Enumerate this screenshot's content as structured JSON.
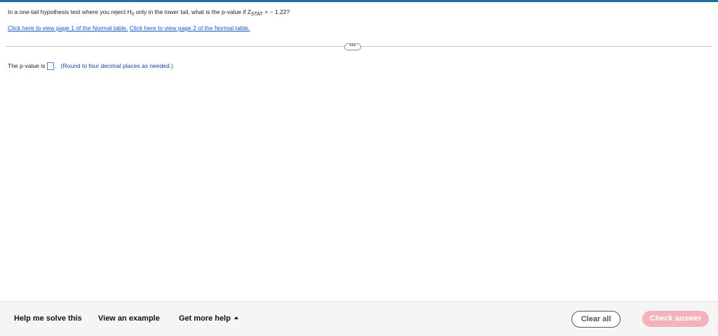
{
  "colors": {
    "top_rule": "#1f6f9c",
    "link": "#1a57c4",
    "hint": "#1a3f9c",
    "check_button_bg": "#f3b3bd",
    "footer_bg": "#f5f5f5"
  },
  "question": {
    "text_before_h": "In a one-tail hypothesis test where you reject H",
    "h_subscript": "0",
    "text_middle": " only in the lower tail, what is the p-value if Z",
    "z_subscript": "STAT",
    "text_after": " = − 1.22?"
  },
  "links": {
    "page1": "Click here to view page 1 of the Normal table.",
    "page2": "Click here to view page 2 of the Normal table."
  },
  "toggle": {
    "label": "•••"
  },
  "answer": {
    "prefix": "The p-value is",
    "value": "",
    "suffix": ".",
    "hint": "(Round to four decimal places as needed.)"
  },
  "footer": {
    "help_solve": "Help me solve this",
    "view_example": "View an example",
    "more_help": "Get more help",
    "more_help_icon": "caret-up-icon",
    "clear_all": "Clear all",
    "check_answer": "Check answer"
  }
}
